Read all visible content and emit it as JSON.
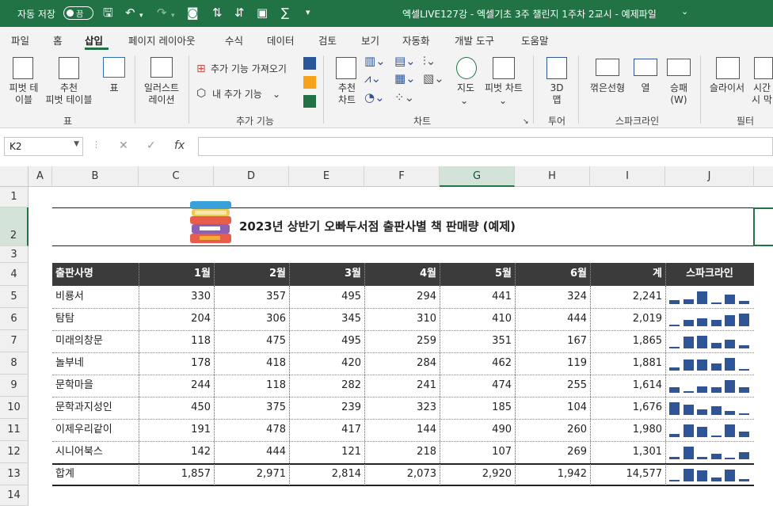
{
  "titlebar": {
    "autosave_label": "자동 저장",
    "autosave_state": "끔",
    "document_title": "엑셀LIVE127강 - 엑셀기초 3주 챌린지 1주차 2교시 - 예제파일",
    "dropdown": "⌄"
  },
  "menu": [
    "파일",
    "홈",
    "삽입",
    "페이지 레이아웃",
    "수식",
    "데이터",
    "검토",
    "보기",
    "자동화",
    "개발 도구",
    "도움말"
  ],
  "ribbon": {
    "pivot": "피벗 테\n이블",
    "recommended_pivot": "추천\n피벗 테이블",
    "table": "표",
    "group_tables": "표",
    "illustrations": "일러스트\n레이션",
    "get_addins": "추가 기능 가져오기",
    "my_addins": "내 추가 기능",
    "group_addins": "추가 기능",
    "recommended_charts": "추천\n차트",
    "maps": "지도",
    "pivot_chart": "피벗 차트",
    "group_charts": "차트",
    "map3d": "3D\n맵",
    "group_tours": "투어",
    "line": "꺾은선형",
    "column": "열",
    "winloss": "승패\n(W)",
    "group_sparklines": "스파크라인",
    "slicer": "슬라이서",
    "timeline": "시간\n시 막",
    "group_filters": "필터"
  },
  "formula_bar": {
    "name_box": "K2",
    "formula": ""
  },
  "columns": [
    "A",
    "B",
    "C",
    "D",
    "E",
    "F",
    "G",
    "H",
    "I",
    "J"
  ],
  "rows": [
    "1",
    "2",
    "3",
    "4",
    "5",
    "6",
    "7",
    "8",
    "9",
    "10",
    "11",
    "12",
    "13",
    "14"
  ],
  "sheet": {
    "title": "2023년 상반기 오빠두서점 출판사별 책 판매량 (예제)",
    "headers": [
      "출판사명",
      "1월",
      "2월",
      "3월",
      "4월",
      "5월",
      "6월",
      "계",
      "스파크라인"
    ],
    "data": [
      {
        "name": "비룡서",
        "values": [
          "330",
          "357",
          "495",
          "294",
          "441",
          "324"
        ],
        "total": "2,241",
        "spark": [
          330,
          357,
          495,
          294,
          441,
          324
        ]
      },
      {
        "name": "탐탐",
        "values": [
          "204",
          "306",
          "345",
          "310",
          "410",
          "444"
        ],
        "total": "2,019",
        "spark": [
          204,
          306,
          345,
          310,
          410,
          444
        ]
      },
      {
        "name": "미래의창문",
        "values": [
          "118",
          "475",
          "495",
          "259",
          "351",
          "167"
        ],
        "total": "1,865",
        "spark": [
          118,
          475,
          495,
          259,
          351,
          167
        ]
      },
      {
        "name": "놀부네",
        "values": [
          "178",
          "418",
          "420",
          "284",
          "462",
          "119"
        ],
        "total": "1,881",
        "spark": [
          178,
          418,
          420,
          284,
          462,
          119
        ]
      },
      {
        "name": "문학마을",
        "values": [
          "244",
          "118",
          "282",
          "241",
          "474",
          "255"
        ],
        "total": "1,614",
        "spark": [
          244,
          118,
          282,
          241,
          474,
          255
        ]
      },
      {
        "name": "문학과지성인",
        "values": [
          "450",
          "375",
          "239",
          "323",
          "185",
          "104"
        ],
        "total": "1,676",
        "spark": [
          450,
          375,
          239,
          323,
          185,
          104
        ]
      },
      {
        "name": "이제우리같이",
        "values": [
          "191",
          "478",
          "417",
          "144",
          "490",
          "260"
        ],
        "total": "1,980",
        "spark": [
          191,
          478,
          417,
          144,
          490,
          260
        ]
      },
      {
        "name": "시니어북스",
        "values": [
          "142",
          "444",
          "121",
          "218",
          "107",
          "269"
        ],
        "total": "1,301",
        "spark": [
          142,
          444,
          121,
          218,
          107,
          269
        ]
      }
    ],
    "total_row": {
      "name": "합계",
      "values": [
        "1,857",
        "2,971",
        "2,814",
        "2,073",
        "2,920",
        "1,942"
      ],
      "total": "14,577",
      "spark": [
        1857,
        2971,
        2814,
        2073,
        2920,
        1942
      ]
    }
  },
  "colors": {
    "accent": "#217346",
    "header_fill": "#3b3b3b",
    "sparkline": "#2f5597"
  }
}
